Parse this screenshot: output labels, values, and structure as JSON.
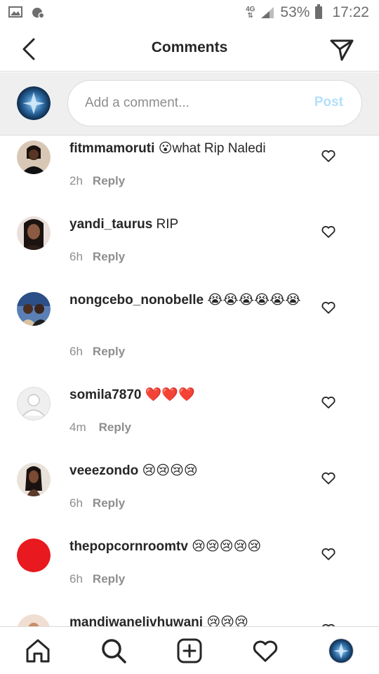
{
  "status_bar": {
    "network": "4G",
    "battery": "53%",
    "time": "17:22"
  },
  "header": {
    "title": "Comments",
    "back_icon": "chevron-left-icon",
    "send_icon": "paper-plane-icon"
  },
  "composer": {
    "placeholder": "Add a comment...",
    "post_label": "Post"
  },
  "comments": [
    {
      "username": "fitmmamoruti",
      "text": "😮what Rip Naledi",
      "time": "2h",
      "reply": "Reply"
    },
    {
      "username": "yandi_taurus",
      "text": "RIP",
      "time": "6h",
      "reply": "Reply"
    },
    {
      "username": "nongcebo_nonobelle",
      "text": "😭😭😭😭😭😭",
      "time": "6h",
      "reply": "Reply"
    },
    {
      "username": "somila7870",
      "text": "❤️❤️❤️",
      "time": "4m",
      "reply": "Reply"
    },
    {
      "username": "veeezondo",
      "text": "😢😢😢😢",
      "time": "6h",
      "reply": "Reply"
    },
    {
      "username": "thepopcornroomtv",
      "text": "😢😢😢😢😢",
      "time": "6h",
      "reply": "Reply"
    },
    {
      "username": "mandiwanelivhuwani",
      "text": "😢😢😢",
      "time": "",
      "reply": ""
    }
  ],
  "bottom_nav": [
    "home-icon",
    "search-icon",
    "new-post-icon",
    "activity-heart-icon",
    "profile-avatar"
  ],
  "colors": {
    "post_disabled": "#b2dffc",
    "secondary_text": "#8e8e8e",
    "red_avatar": "#e8191f"
  }
}
